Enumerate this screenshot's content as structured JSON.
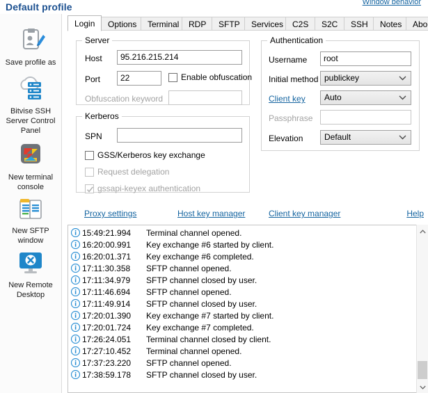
{
  "header": {
    "title": "Default profile",
    "window_behavior_link": "Window behavior"
  },
  "sidebar": {
    "items": [
      {
        "label": "Save profile as",
        "icon": "save-profile-icon"
      },
      {
        "label": "Bitvise SSH Server Control Panel",
        "icon": "server-control-panel-icon"
      },
      {
        "label": "New terminal console",
        "icon": "terminal-console-icon"
      },
      {
        "label": "New SFTP window",
        "icon": "sftp-window-icon"
      },
      {
        "label": "New Remote Desktop",
        "icon": "remote-desktop-icon"
      }
    ]
  },
  "tabs": [
    {
      "label": "Login",
      "selected": true
    },
    {
      "label": "Options",
      "selected": false
    },
    {
      "label": "Terminal",
      "selected": false
    },
    {
      "label": "RDP",
      "selected": false
    },
    {
      "label": "SFTP",
      "selected": false
    },
    {
      "label": "Services",
      "selected": false
    },
    {
      "label": "C2S",
      "selected": false
    },
    {
      "label": "S2C",
      "selected": false
    },
    {
      "label": "SSH",
      "selected": false
    },
    {
      "label": "Notes",
      "selected": false
    },
    {
      "label": "About",
      "selected": false
    }
  ],
  "server": {
    "title": "Server",
    "host_label": "Host",
    "host_value": "95.216.215.214",
    "port_label": "Port",
    "port_value": "22",
    "enable_obfuscation_label": "Enable obfuscation",
    "enable_obfuscation_checked": false,
    "obfuscation_keyword_label": "Obfuscation keyword",
    "obfuscation_keyword_value": ""
  },
  "kerberos": {
    "title": "Kerberos",
    "spn_label": "SPN",
    "spn_value": "",
    "gss_label": "GSS/Kerberos key exchange",
    "gss_checked": false,
    "request_delegation_label": "Request delegation",
    "request_delegation_checked": false,
    "gssapi_keyex_label": "gssapi-keyex authentication",
    "gssapi_keyex_checked": true
  },
  "authentication": {
    "title": "Authentication",
    "username_label": "Username",
    "username_value": "root",
    "initial_method_label": "Initial method",
    "initial_method_value": "publickey",
    "client_key_label": "Client key",
    "client_key_value": "Auto",
    "passphrase_label": "Passphrase",
    "passphrase_value": "",
    "elevation_label": "Elevation",
    "elevation_value": "Default"
  },
  "bottom_links": [
    {
      "label": "Proxy settings"
    },
    {
      "label": "Host key manager"
    },
    {
      "label": "Client key manager"
    },
    {
      "label": "Help"
    }
  ],
  "log": {
    "entries": [
      {
        "icon": "info-icon",
        "time": "15:49:21.994",
        "message": "Terminal channel opened."
      },
      {
        "icon": "info-icon",
        "time": "16:20:00.991",
        "message": "Key exchange #6 started by client."
      },
      {
        "icon": "info-icon",
        "time": "16:20:01.371",
        "message": "Key exchange #6 completed."
      },
      {
        "icon": "info-icon",
        "time": "17:11:30.358",
        "message": "SFTP channel opened."
      },
      {
        "icon": "info-icon",
        "time": "17:11:34.979",
        "message": "SFTP channel closed by user."
      },
      {
        "icon": "info-icon",
        "time": "17:11:46.694",
        "message": "SFTP channel opened."
      },
      {
        "icon": "info-icon",
        "time": "17:11:49.914",
        "message": "SFTP channel closed by user."
      },
      {
        "icon": "info-icon",
        "time": "17:20:01.390",
        "message": "Key exchange #7 started by client."
      },
      {
        "icon": "info-icon",
        "time": "17:20:01.724",
        "message": "Key exchange #7 completed."
      },
      {
        "icon": "info-icon",
        "time": "17:26:24.051",
        "message": "Terminal channel closed by client."
      },
      {
        "icon": "info-icon",
        "time": "17:27:10.452",
        "message": "Terminal channel opened."
      },
      {
        "icon": "info-icon",
        "time": "17:37:23.220",
        "message": "SFTP channel opened."
      },
      {
        "icon": "info-icon",
        "time": "17:38:59.178",
        "message": "SFTP channel closed by user."
      }
    ]
  },
  "colors": {
    "title_blue": "#1a4f8f",
    "link_blue": "#1464a0",
    "info_blue": "#2a8fd4",
    "tab_inactive": "#f0f0f0",
    "sidebar_bg": "#fbfbfb"
  }
}
